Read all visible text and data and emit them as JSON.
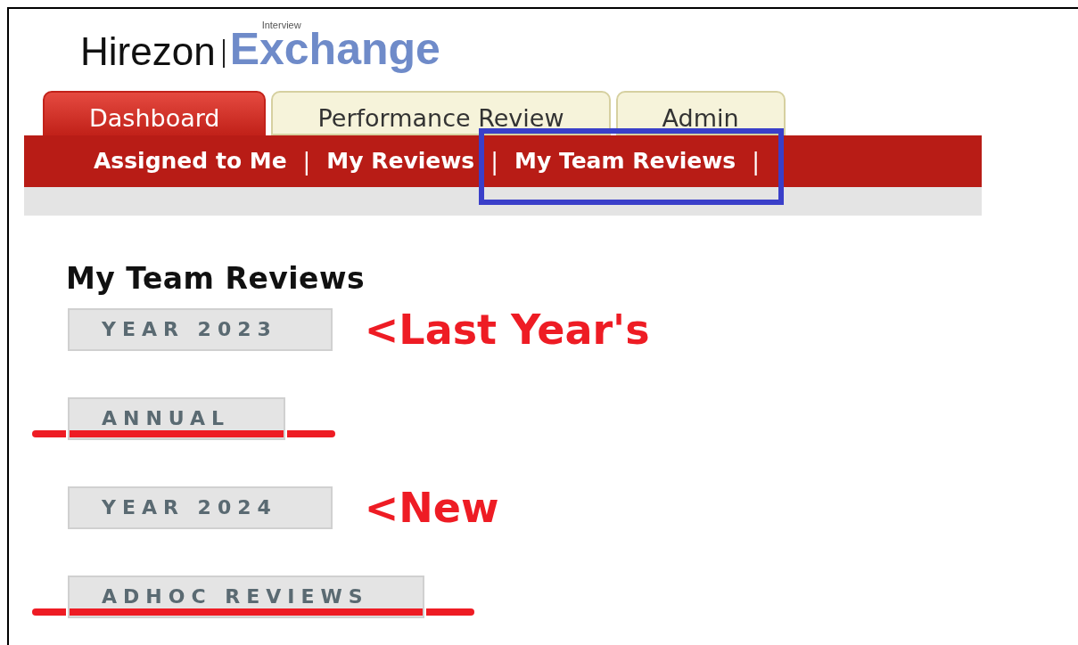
{
  "logo": {
    "brand": "Hirezon",
    "product_small": "Interview",
    "product": "Exchange"
  },
  "tabs": [
    {
      "label": "Dashboard",
      "selected": true
    },
    {
      "label": "Performance Review",
      "selected": false
    },
    {
      "label": "Admin",
      "selected": false
    }
  ],
  "subnav": [
    {
      "label": "Assigned to Me",
      "highlighted": false
    },
    {
      "label": "My Reviews",
      "highlighted": false
    },
    {
      "label": "My Team Reviews",
      "highlighted": true
    }
  ],
  "separator": "|",
  "heading": "My Team Reviews",
  "review_buttons": [
    {
      "label": "YEAR 2023",
      "struck": false,
      "note": "<Last Year's"
    },
    {
      "label": "ANNUAL",
      "struck": true
    },
    {
      "label": "YEAR 2024",
      "struck": false,
      "note": "<New"
    },
    {
      "label": "ADHOC REVIEWS",
      "struck": true
    }
  ]
}
